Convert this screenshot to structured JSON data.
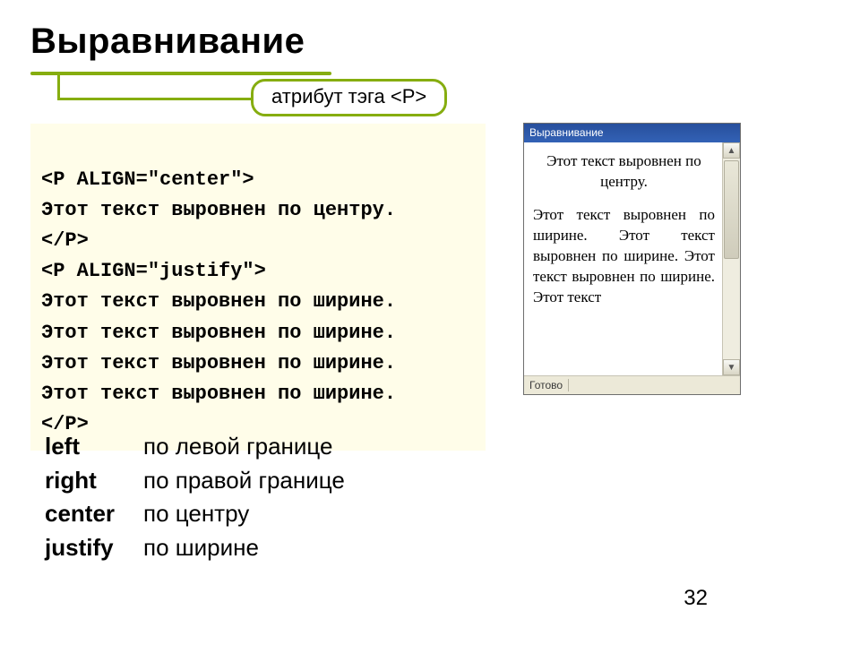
{
  "title": "Выравнивание",
  "callout": "атрибут тэга <P>",
  "code": {
    "l1": "<P ALIGN=\"center\">",
    "l2": "Этот текст выровнен по центру.",
    "l3": "</P>",
    "l4": "<P ALIGN=\"justify\">",
    "l5": "Этот текст выровнен по ширине.",
    "l6": "Этот текст выровнен по ширине.",
    "l7": "Этот текст выровнен по ширине.",
    "l8": "Этот текст выровнен по ширине.",
    "l9": "</P>"
  },
  "browser": {
    "title": "Выравнивание",
    "center_text": "Этот текст выровнен по центру.",
    "justify_text": "Этот текст выровнен по ширине. Этот текст выровнен по ширине. Этот текст выровнен по ширине. Этот текст",
    "status": "Готово",
    "scroll_up": "▲",
    "scroll_down": "▼"
  },
  "aligns": {
    "left_key": "left",
    "left_desc": "по левой границе",
    "right_key": "right",
    "right_desc": "по правой границе",
    "center_key": "center",
    "center_desc": "по центру",
    "justify_key": "justify",
    "justify_desc": "по ширине"
  },
  "page_number": "32"
}
